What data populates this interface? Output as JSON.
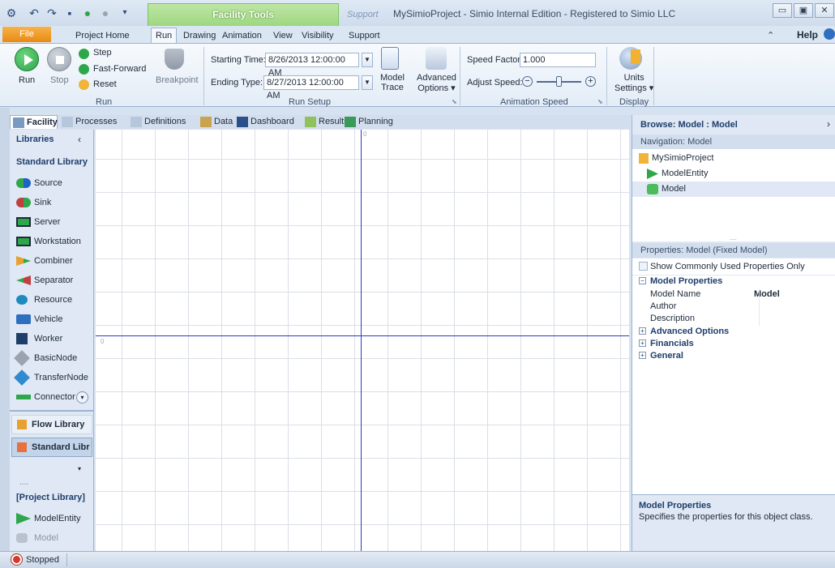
{
  "window": {
    "title": "MySimioProject - Simio Internal Edition - Registered to Simio LLC",
    "context_tab": "Facility Tools",
    "context_support": "Support"
  },
  "ribbon_tabs": [
    "File",
    "Project Home",
    "Run",
    "Drawing",
    "Animation",
    "View",
    "Visibility",
    "Support"
  ],
  "help_label": "Help",
  "ribbon": {
    "run_label": "Run",
    "stop_label": "Stop",
    "step_label": "Step",
    "fast_forward_label": "Fast-Forward",
    "reset_label": "Reset",
    "breakpoint_label": "Breakpoint",
    "run_group": "Run",
    "starting_time_label": "Starting Time:",
    "starting_time_value": "8/26/2013 12:00:00 AM",
    "ending_type_label": "Ending Type:",
    "ending_type_value": "8/27/2013 12:00:00 AM",
    "model_trace_label1": "Model",
    "model_trace_label2": "Trace",
    "advanced_options_label1": "Advanced",
    "advanced_options_label2": "Options ▾",
    "run_setup_group": "Run Setup",
    "speed_factor_label": "Speed Factor:",
    "speed_factor_value": "1.000",
    "adjust_speed_label": "Adjust Speed:",
    "animation_speed_group": "Animation Speed",
    "units_label1": "Units",
    "units_label2": "Settings ▾",
    "display_group": "Display"
  },
  "doc_tabs": [
    "Facility",
    "Processes",
    "Definitions",
    "Data",
    "Dashboard",
    "Results",
    "Planning"
  ],
  "libraries": {
    "header": "Libraries",
    "standard_title": "Standard Library",
    "items": [
      "Source",
      "Sink",
      "Server",
      "Workstation",
      "Combiner",
      "Separator",
      "Resource",
      "Vehicle",
      "Worker",
      "BasicNode",
      "TransferNode",
      "Connector"
    ],
    "flow_library": "Flow Library",
    "standard_library_btn": "Standard Libr",
    "dots": "....",
    "project_library": "[Project Library]",
    "project_items": [
      "ModelEntity",
      "Model"
    ]
  },
  "canvas": {
    "origin_label": "0"
  },
  "browse": {
    "title": "Browse: Model : Model",
    "navigation_header": "Navigation: Model",
    "nav_items": [
      "MySimioProject",
      "ModelEntity",
      "Model"
    ],
    "properties_header": "Properties: Model (Fixed Model)",
    "show_common_label": "Show Commonly Used Properties Only",
    "model_properties": "Model Properties",
    "model_name_label": "Model Name",
    "model_name_value": "Model",
    "author_label": "Author",
    "description_label": "Description",
    "advanced_options": "Advanced Options",
    "financials": "Financials",
    "general": "General",
    "desc_title": "Model Properties",
    "desc_text": "Specifies the properties for this object class."
  },
  "status": {
    "text": "Stopped"
  },
  "colors": {
    "run_green": "#2ea64a",
    "context_green": "#9bd67e",
    "file_orange": "#e88a12",
    "axis_blue": "#2a3cbf"
  }
}
